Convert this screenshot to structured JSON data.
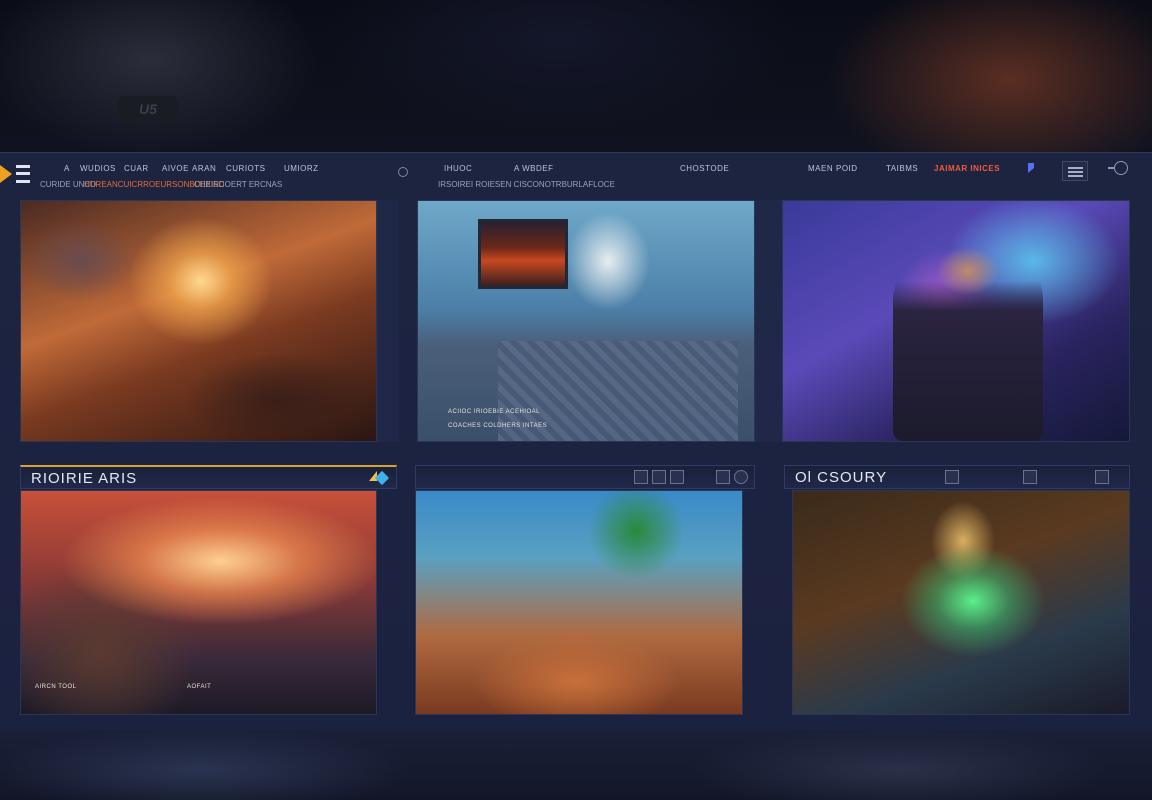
{
  "nav": {
    "row1": [
      "A",
      "WUDIOS",
      "CUAR",
      "AIVOE",
      "ARAN",
      "CURIOTS",
      "UMIORZ"
    ],
    "row2_prefix": "CURIDE UNCD",
    "row2_highlight": "HUREANCUICRROEURSONBUEXISD",
    "row2_suffix": "CHEIRCOERT ERCNAS",
    "center_row1": [
      "IHUOC",
      "A WBDEF"
    ],
    "center_row2": "IRSOIREI ROIESEN CISCONOTRBURLAFLOCE",
    "mid": "CHOSTODE",
    "right": [
      "MAEN",
      "POID",
      "TAIBMS"
    ],
    "right_highlight": "JAIMAR INICES"
  },
  "cards": [
    {
      "name": "card-1",
      "caption1": "",
      "caption2": ""
    },
    {
      "name": "card-2",
      "caption1": "ACIIOC IRIOEBIE ACEHIOAL",
      "caption2": "COACHES COLDHERS INTAES"
    },
    {
      "name": "card-3",
      "caption1": "",
      "caption2": ""
    },
    {
      "name": "card-4",
      "header": "RIOIRIE ARIS",
      "caption1": "AIRCN TOOL",
      "caption2": "AOFAIT"
    },
    {
      "name": "card-5",
      "caption1": "",
      "caption2": ""
    },
    {
      "name": "card-6",
      "header": "Ol CSOURY",
      "caption1": "",
      "caption2": ""
    }
  ],
  "colors": {
    "accent_orange": "#e86a3a",
    "accent_gold": "#d8a030",
    "panel": "#1d2440"
  },
  "icons": [
    "logo-icon",
    "search-icon",
    "flag-icon",
    "menu-icon",
    "user-circle-icon",
    "badge-icon"
  ]
}
